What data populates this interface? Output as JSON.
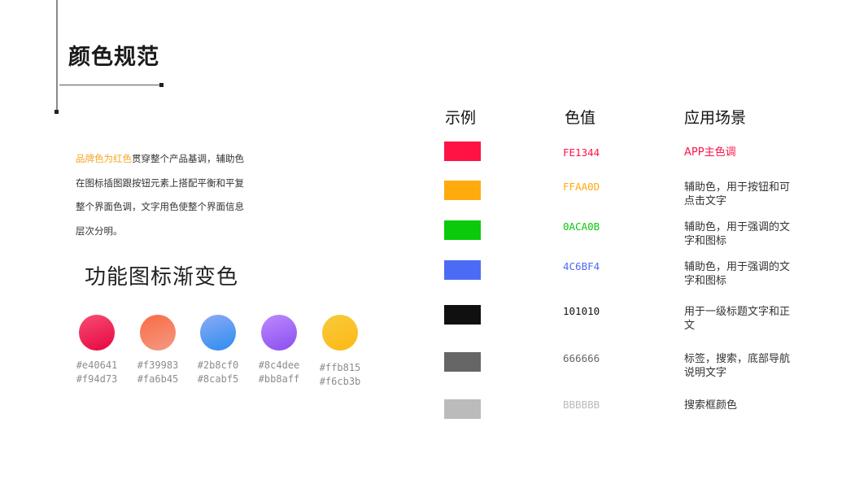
{
  "page": {
    "title": "颜色规范"
  },
  "description": {
    "highlight": "品牌色为红色",
    "line1_rest": "贯穿整个产品基调，辅助色",
    "line2": "在图标插图跟按钮元素上搭配平衡和平复",
    "line3": "整个界面色调，文字用色使整个界面信息",
    "line4": "层次分明。"
  },
  "gradients": {
    "title": "功能图标渐变色",
    "items": [
      {
        "from": "#e40641",
        "to": "#f94d73"
      },
      {
        "from": "#f39983",
        "to": "#fa6b45"
      },
      {
        "from": "#2b8cf0",
        "to": "#8cabf5"
      },
      {
        "from": "#8c4dee",
        "to": "#bb8aff"
      },
      {
        "from": "#ffb815",
        "to": "#f6cb3b"
      }
    ]
  },
  "table": {
    "headers": {
      "example": "示例",
      "value": "色值",
      "usage": "应用场景"
    },
    "rows": [
      {
        "swatch": "#FE1344",
        "hex": "FE1344",
        "hex_color": "#FE1344",
        "usage_l1": "APP主色调",
        "usage_l2": "",
        "usage_color": "#FE1344"
      },
      {
        "swatch": "#FFAA0D",
        "hex": "FFAA0D",
        "hex_color": "#FFAA0D",
        "usage_l1": "辅助色，用于按钮和可",
        "usage_l2": "点击文字",
        "usage_color": "#333333"
      },
      {
        "swatch": "#0ACA0B",
        "hex": "0ACA0B",
        "hex_color": "#0ACA0B",
        "usage_l1": "辅助色，用于强调的文",
        "usage_l2": "字和图标",
        "usage_color": "#333333"
      },
      {
        "swatch": "#4C6BF4",
        "hex": "4C6BF4",
        "hex_color": "#4C6BF4",
        "usage_l1": "辅助色，用于强调的文",
        "usage_l2": "字和图标",
        "usage_color": "#333333"
      },
      {
        "swatch": "#101010",
        "hex": "101010",
        "hex_color": "#101010",
        "usage_l1": "用于一级标题文字和正",
        "usage_l2": "文",
        "usage_color": "#333333"
      },
      {
        "swatch": "#666666",
        "hex": "666666",
        "hex_color": "#666666",
        "usage_l1": "标签，搜索，底部导航",
        "usage_l2": "说明文字",
        "usage_color": "#333333"
      },
      {
        "swatch": "#BBBBBB",
        "hex": "BBBBBB",
        "hex_color": "#BBBBBB",
        "usage_l1": "搜索框颜色",
        "usage_l2": "",
        "usage_color": "#333333"
      }
    ]
  }
}
